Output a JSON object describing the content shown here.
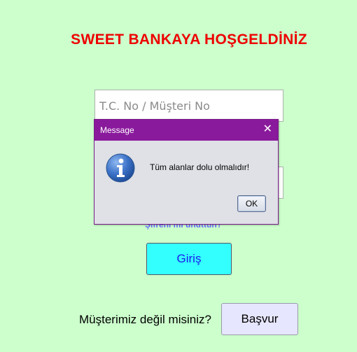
{
  "header": {
    "title": "SWEET BANKAYA HOŞGELDİNİZ"
  },
  "login": {
    "id_placeholder": "T.C. No / Müşteri No",
    "password_placeholder": "",
    "forgot_link": "Şifreni mi unuttun?",
    "login_button": "Giriş"
  },
  "signup": {
    "prompt": "Müşterimiz değil misiniz?",
    "apply_button": "Başvur"
  },
  "dialog": {
    "title": "Message",
    "close_symbol": "✕",
    "icon": "info-icon",
    "message": "Tüm alanlar dolu olmalıdır!",
    "ok_label": "OK"
  },
  "colors": {
    "background": "#ccffcc",
    "title": "#ee0000",
    "dialog_titlebar": "#8a1a9c",
    "login_button": "#33ffff",
    "apply_button": "#e6e6ff",
    "link": "#6b6bff"
  }
}
